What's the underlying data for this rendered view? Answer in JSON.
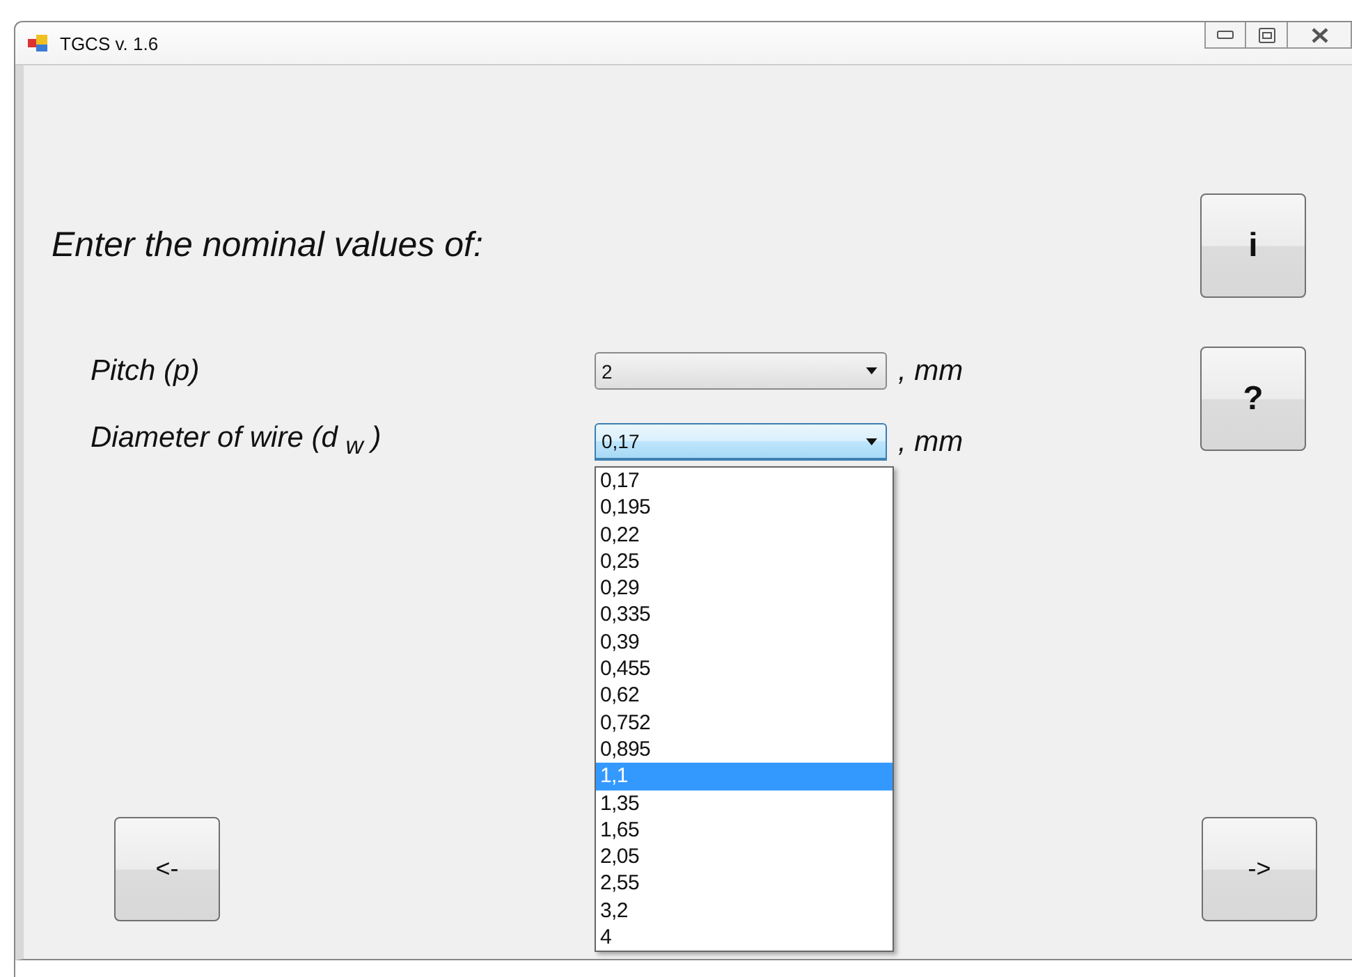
{
  "window": {
    "title": "TGCS v. 1.6"
  },
  "heading": "Enter the nominal values of:",
  "info_button": "i",
  "help_button": "?",
  "fields": [
    {
      "label": "Pitch (p)",
      "value": "2",
      "unit": ", mm",
      "focused": false,
      "open": false
    },
    {
      "label": "Diameter of wire (d $_{w}$ )",
      "value": "0,17",
      "unit": ", mm",
      "focused": true,
      "open": true
    }
  ],
  "dropdown_items": [
    {
      "text": "0,17",
      "selected": false
    },
    {
      "text": "0,195",
      "selected": false
    },
    {
      "text": "0,22",
      "selected": false
    },
    {
      "text": "0,25",
      "selected": false
    },
    {
      "text": "0,29",
      "selected": false
    },
    {
      "text": "0,335",
      "selected": false
    },
    {
      "text": "0,39",
      "selected": false
    },
    {
      "text": "0,455",
      "selected": false
    },
    {
      "text": "0,62",
      "selected": false
    },
    {
      "text": "0,752",
      "selected": false
    },
    {
      "text": "0,895",
      "selected": false
    },
    {
      "text": "1,1",
      "selected": true
    },
    {
      "text": "1,35",
      "selected": false
    },
    {
      "text": "1,65",
      "selected": false
    },
    {
      "text": "2,05",
      "selected": false
    },
    {
      "text": "2,55",
      "selected": false
    },
    {
      "text": "3,2",
      "selected": false
    },
    {
      "text": "4",
      "selected": false
    }
  ],
  "back_button": "<-",
  "next_button": "->"
}
